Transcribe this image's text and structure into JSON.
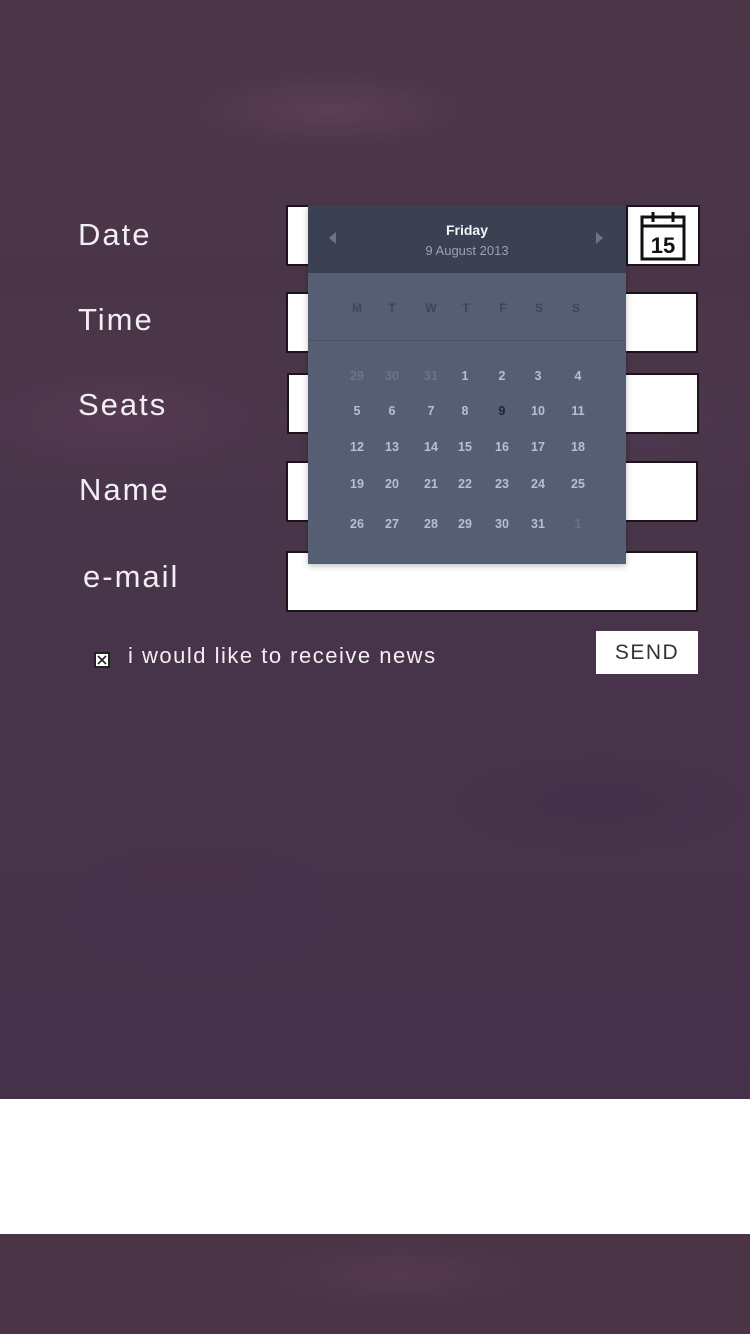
{
  "form": {
    "date_label": "Date",
    "time_label": "Time",
    "seats_label": "Seats",
    "name_label": "Name",
    "email_label": "e-mail",
    "calendar_icon_day": "15",
    "news_label": "i would like to receive news",
    "send_label": "SEND"
  },
  "datepicker": {
    "weekday_name": "Friday",
    "full_date": "9 August 2013",
    "weekdays": [
      "M",
      "T",
      "W",
      "T",
      "F",
      "S",
      "S"
    ],
    "weeks": [
      [
        {
          "d": "29",
          "m": true
        },
        {
          "d": "30",
          "m": true
        },
        {
          "d": "31",
          "m": true
        },
        {
          "d": "1"
        },
        {
          "d": "2"
        },
        {
          "d": "3"
        },
        {
          "d": "4"
        }
      ],
      [
        {
          "d": "5"
        },
        {
          "d": "6"
        },
        {
          "d": "7"
        },
        {
          "d": "8"
        },
        {
          "d": "9",
          "sel": true
        },
        {
          "d": "10"
        },
        {
          "d": "11"
        }
      ],
      [
        {
          "d": "12"
        },
        {
          "d": "13"
        },
        {
          "d": "14"
        },
        {
          "d": "15"
        },
        {
          "d": "16"
        },
        {
          "d": "17"
        },
        {
          "d": "18"
        }
      ],
      [
        {
          "d": "19"
        },
        {
          "d": "20"
        },
        {
          "d": "21"
        },
        {
          "d": "22"
        },
        {
          "d": "23"
        },
        {
          "d": "24"
        },
        {
          "d": "25"
        }
      ],
      [
        {
          "d": "26"
        },
        {
          "d": "27"
        },
        {
          "d": "28"
        },
        {
          "d": "29"
        },
        {
          "d": "30"
        },
        {
          "d": "31"
        },
        {
          "d": "1",
          "m": true
        }
      ]
    ]
  }
}
